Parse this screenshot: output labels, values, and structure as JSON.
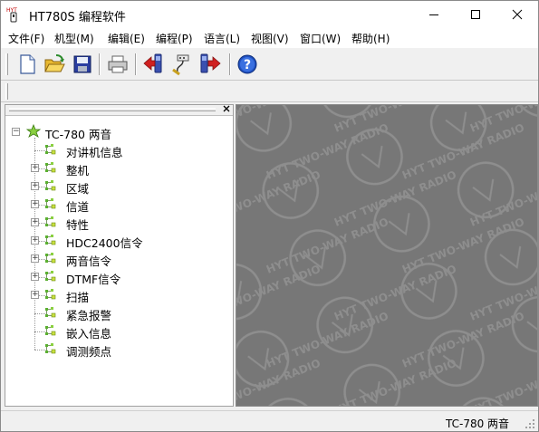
{
  "window": {
    "title": "HT780S 编程软件",
    "icon_text": "HYT"
  },
  "menu": [
    {
      "label": "文件(F)"
    },
    {
      "label": "机型(M)"
    },
    {
      "label": "编辑(E)"
    },
    {
      "label": "编程(P)"
    },
    {
      "label": "语言(L)"
    },
    {
      "label": "视图(V)"
    },
    {
      "label": "窗口(W)"
    },
    {
      "label": "帮助(H)"
    }
  ],
  "toolbar": {
    "buttons": [
      "new-file-icon",
      "open-folder-icon",
      "save-disk-icon",
      "print-icon",
      "read-radio-icon",
      "connect-icon",
      "write-radio-icon",
      "help-icon"
    ]
  },
  "tree": {
    "root": "TC-780 两音",
    "items": [
      {
        "label": "对讲机信息",
        "expandable": false
      },
      {
        "label": "整机",
        "expandable": true
      },
      {
        "label": "区域",
        "expandable": true
      },
      {
        "label": "信道",
        "expandable": true
      },
      {
        "label": "特性",
        "expandable": true
      },
      {
        "label": "HDC2400信令",
        "expandable": true
      },
      {
        "label": "两音信令",
        "expandable": true
      },
      {
        "label": "DTMF信令",
        "expandable": true
      },
      {
        "label": "扫描",
        "expandable": true
      },
      {
        "label": "紧急报警",
        "expandable": false
      },
      {
        "label": "嵌入信息",
        "expandable": false
      },
      {
        "label": "调测频点",
        "expandable": false
      }
    ]
  },
  "watermark": {
    "text": "HYT TWO-WAY RADIO"
  },
  "status": {
    "model": "TC-780 两音"
  },
  "colors": {
    "mdi_background": "#777777",
    "watermark": "#8e8e8e"
  }
}
